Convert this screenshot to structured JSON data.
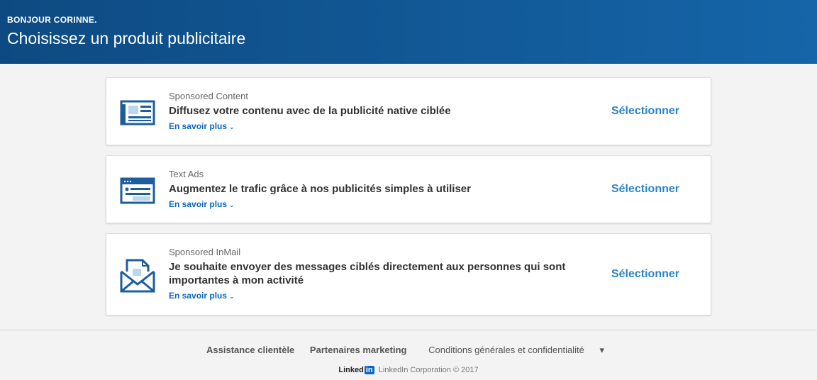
{
  "header": {
    "greeting": "BONJOUR CORINNE.",
    "title": "Choisissez un produit publicitaire"
  },
  "products": [
    {
      "name": "Sponsored Content",
      "description": "Diffusez votre contenu avec de la publicité native ciblée",
      "learn_more": "En savoir plus",
      "select_label": "Sélectionner",
      "icon": "newspaper-icon"
    },
    {
      "name": "Text Ads",
      "description": "Augmentez le trafic grâce à nos publicités simples à utiliser",
      "learn_more": "En savoir plus",
      "select_label": "Sélectionner",
      "icon": "browser-window-icon"
    },
    {
      "name": "Sponsored InMail",
      "description": "Je souhaite envoyer des messages ciblés directement aux personnes qui sont importantes à mon activité",
      "learn_more": "En savoir plus",
      "select_label": "Sélectionner",
      "icon": "envelope-icon"
    }
  ],
  "footer": {
    "links": [
      "Assistance clientèle",
      "Partenaires marketing",
      "Conditions générales et confidentialité"
    ],
    "logo_text": "Linked",
    "logo_in": "in",
    "copyright": "LinkedIn Corporation © 2017"
  },
  "colors": {
    "header_start": "#0e4a82",
    "header_end": "#1565a8",
    "link": "#0a66c2",
    "select": "#2a84c4",
    "icon": "#1e5d9c"
  }
}
